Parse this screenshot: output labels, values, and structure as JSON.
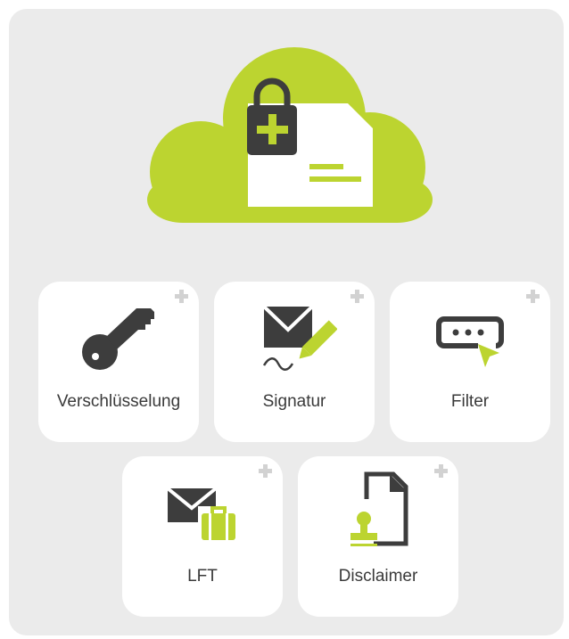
{
  "colors": {
    "accent": "#bcd430",
    "icon_dark": "#3d3d3d",
    "tile_bg": "#ffffff",
    "panel_bg": "#ebebeb",
    "plus": "#d2d2d2"
  },
  "hero": {
    "icon": "cloud-lock-document-icon"
  },
  "tiles": [
    {
      "label": "Verschlüsselung",
      "icon": "key-icon"
    },
    {
      "label": "Signatur",
      "icon": "envelope-signature-icon"
    },
    {
      "label": "Filter",
      "icon": "password-filter-icon"
    },
    {
      "label": "LFT",
      "icon": "envelope-briefcase-icon"
    },
    {
      "label": "Disclaimer",
      "icon": "document-stamp-icon"
    }
  ],
  "expand_icon": "plus-icon"
}
